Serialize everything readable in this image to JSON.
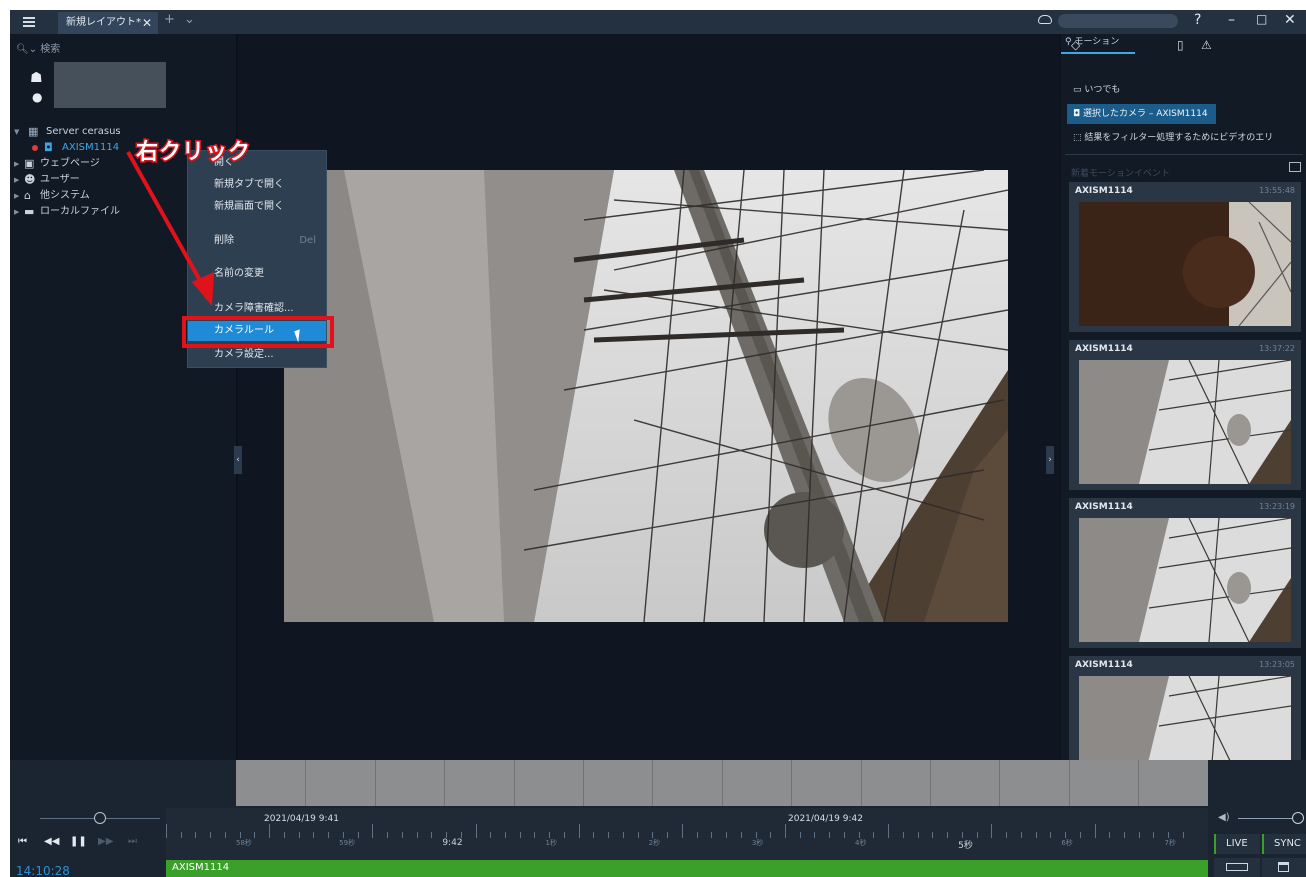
{
  "titlebar": {
    "tab_label": "新規レイアウト*",
    "tab_close": "✕",
    "tab_add": "+",
    "tab_list": "⌄",
    "help": "?",
    "minimize": "–",
    "maximize": "□",
    "close": "✕"
  },
  "left_panel": {
    "search_label": "🔍︎⌄ 検索",
    "tree": {
      "server": "Server cerasus",
      "camera": "AXISM1114",
      "webpages": "ウェブページ",
      "users": "ユーザー",
      "other_systems": "他システム",
      "local_files": "ローカルファイル"
    }
  },
  "context_menu": {
    "items": [
      {
        "label": "開く",
        "shortcut": ""
      },
      {
        "label": "新規タブで開く",
        "shortcut": ""
      },
      {
        "label": "新規画面で開く",
        "shortcut": ""
      },
      {
        "label": "削除",
        "shortcut": "Del"
      },
      {
        "label": "名前の変更",
        "shortcut": ""
      },
      {
        "label": "カメラ障害確認...",
        "shortcut": ""
      },
      {
        "label": "カメラルール",
        "shortcut": ""
      },
      {
        "label": "カメラ設定...",
        "shortcut": ""
      }
    ],
    "highlighted": "カメラルール"
  },
  "annotation": {
    "text": "右クリック",
    "color": "#e2121b"
  },
  "right_panel": {
    "tabs": {
      "motion": "モーション"
    },
    "filters": {
      "anytime": "いつでも",
      "selected_camera": "選択したカメラ – AXISM1114",
      "area_filter": "結果をフィルター処理するためにビデオのエリ"
    },
    "list_header": "新着モーションイベント",
    "events": [
      {
        "camera": "AXISM1114",
        "time": "13:55:48"
      },
      {
        "camera": "AXISM1114",
        "time": "13:37:22"
      },
      {
        "camera": "AXISM1114",
        "time": "13:23:19"
      },
      {
        "camera": "AXISM1114",
        "time": "13:23:05"
      }
    ]
  },
  "timeline": {
    "date_left": "2021/04/19 9:41",
    "date_right": "2021/04/19 9:42",
    "labels": [
      {
        "text": "58秒"
      },
      {
        "text": "59秒"
      },
      {
        "text": "9:42"
      },
      {
        "text": "1秒"
      },
      {
        "text": "2秒"
      },
      {
        "text": "3秒"
      },
      {
        "text": "4秒"
      },
      {
        "text": "5秒"
      },
      {
        "text": "6秒"
      },
      {
        "text": "7秒"
      }
    ],
    "camera_track": "AXISM1114",
    "current_time": "14:10:28",
    "live": "LIVE",
    "sync": "SYNC"
  },
  "colors": {
    "accent": "#1f8ad6",
    "track_green": "#3aa02a",
    "highlight_red": "#e2121b",
    "background": "#0f1621"
  }
}
